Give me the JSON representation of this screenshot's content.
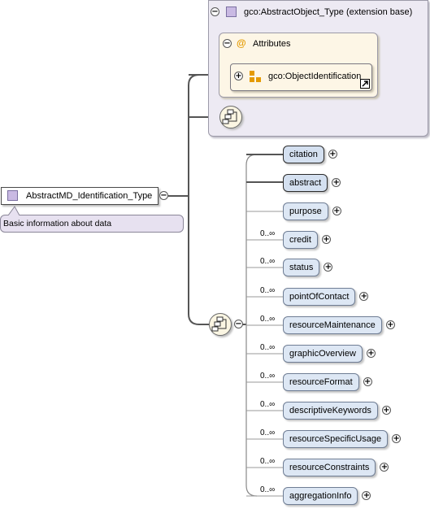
{
  "extension": {
    "title": "gco:AbstractObject_Type (extension base)",
    "attributes_label": "Attributes",
    "attribute_group": "gco:ObjectIdentification"
  },
  "root": {
    "name": "AbstractMD_Identification_Type",
    "documentation": "Basic information about data"
  },
  "occurrence": "0..∞",
  "children": [
    {
      "name": "citation",
      "required": true
    },
    {
      "name": "abstract",
      "required": true
    },
    {
      "name": "purpose",
      "required": false
    },
    {
      "name": "credit",
      "required": false,
      "multi": true
    },
    {
      "name": "status",
      "required": false,
      "multi": true
    },
    {
      "name": "pointOfContact",
      "required": false,
      "multi": true
    },
    {
      "name": "resourceMaintenance",
      "required": false,
      "multi": true
    },
    {
      "name": "graphicOverview",
      "required": false,
      "multi": true
    },
    {
      "name": "resourceFormat",
      "required": false,
      "multi": true
    },
    {
      "name": "descriptiveKeywords",
      "required": false,
      "multi": true
    },
    {
      "name": "resourceSpecificUsage",
      "required": false,
      "multi": true
    },
    {
      "name": "resourceConstraints",
      "required": false,
      "multi": true
    },
    {
      "name": "aggregationInfo",
      "required": false,
      "multi": true
    }
  ]
}
